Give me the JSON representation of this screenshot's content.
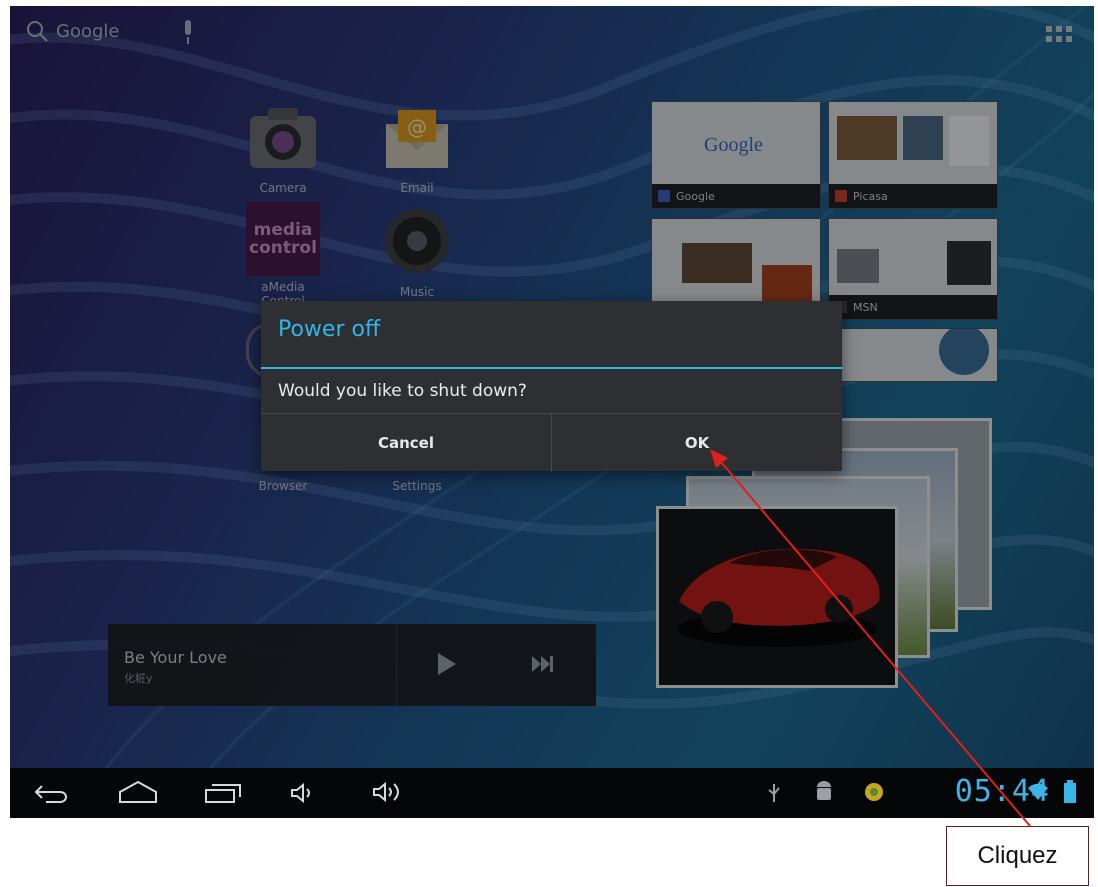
{
  "search": {
    "label": "Google"
  },
  "apps": [
    {
      "label": "Camera"
    },
    {
      "label": "Email"
    },
    {
      "label": "aMedia Control",
      "logo_top": "media",
      "logo_bottom": "control"
    },
    {
      "label": "Music"
    },
    {
      "label": "Browser"
    },
    {
      "label": "Settings"
    }
  ],
  "thumbnails": [
    {
      "caption": "Google",
      "body": "Google"
    },
    {
      "caption": "Picasa"
    },
    {
      "caption": ""
    },
    {
      "caption": "MSN"
    }
  ],
  "music_widget": {
    "title": "Be Your Love",
    "artist": "化粧y"
  },
  "dialog": {
    "title": "Power off",
    "message": "Would you like to shut down?",
    "cancel_label": "Cancel",
    "ok_label": "OK"
  },
  "status": {
    "time": "05:44"
  },
  "annotation": {
    "label": "Cliquez"
  },
  "colors": {
    "accent": "#33b5e5",
    "arrow": "#e0201c"
  }
}
